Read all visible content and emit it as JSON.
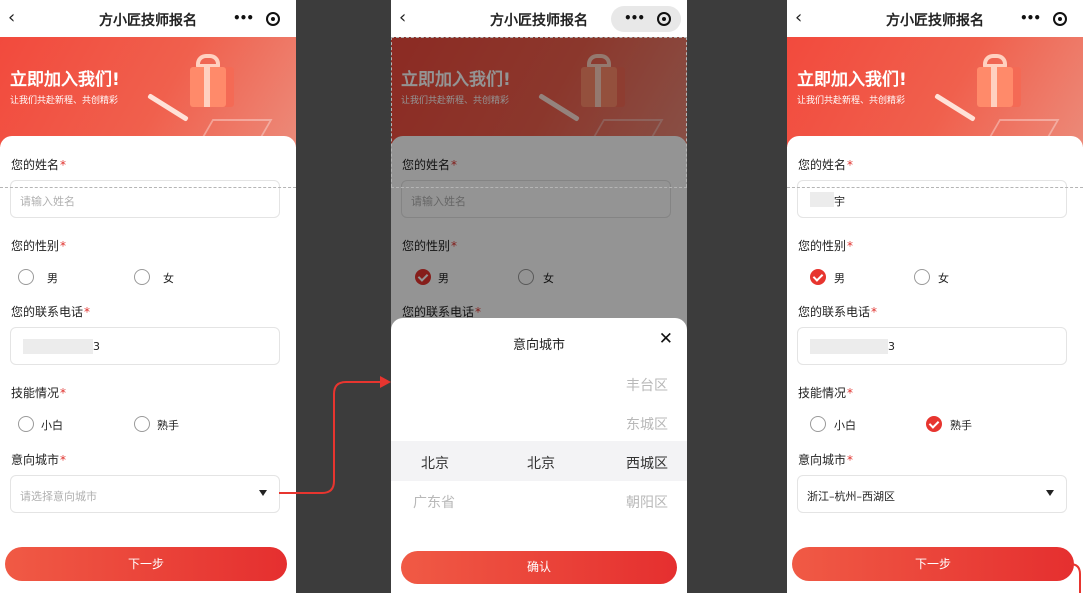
{
  "app": {
    "title": "方小匠技师报名",
    "back_glyph": "‹",
    "menu_glyph": "•••"
  },
  "banner": {
    "title": "立即加入我们!",
    "subtitle": "让我们共赴新程、共创精彩"
  },
  "form": {
    "name_label": "您的姓名",
    "name_placeholder": "请输入姓名",
    "gender_label": "您的性别",
    "gender_options": [
      "男",
      "女"
    ],
    "phone_label": "您的联系电话",
    "skill_label": "技能情况",
    "skill_options": [
      "小白",
      "熟手"
    ],
    "city_label": "意向城市",
    "city_placeholder": "请选择意向城市",
    "required_mark": "*",
    "next_button": "下一步"
  },
  "screens": [
    {
      "name_value": "",
      "phone_value": "3",
      "gender_selected": null,
      "skill_selected": null,
      "city_value": ""
    },
    {
      "name_value": "",
      "phone_value": "",
      "gender_selected": "男",
      "skill_selected": null,
      "city_value": ""
    },
    {
      "name_value": "宇",
      "phone_value": "3",
      "gender_selected": "男",
      "skill_selected": "熟手",
      "city_value": "浙江–杭州–西湖区"
    }
  ],
  "picker": {
    "title": "意向城市",
    "close_glyph": "✕",
    "columns": [
      {
        "items": [
          "北京",
          "广东省"
        ],
        "selected": "北京"
      },
      {
        "items": [
          "北京"
        ],
        "selected": "北京"
      },
      {
        "items": [
          "丰台区",
          "东城区",
          "西城区",
          "朝阳区"
        ],
        "selected": "西城区"
      }
    ],
    "confirm_button": "确认"
  },
  "colors": {
    "accent": "#e7352f",
    "banner_start": "#f24a3d",
    "divider_dark": "#3c3c3c"
  }
}
